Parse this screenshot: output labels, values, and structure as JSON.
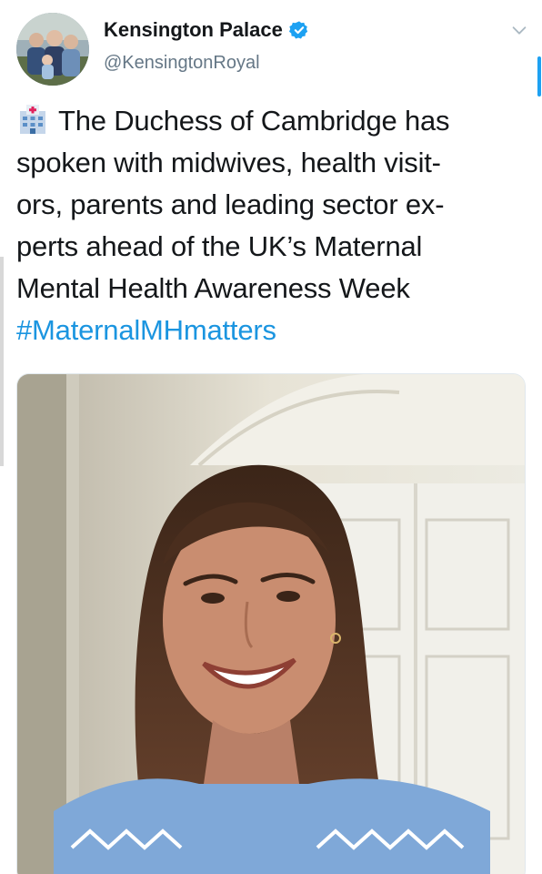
{
  "account": {
    "display_name": "Kensington Palace",
    "handle": "@KensingtonRoyal",
    "verified_icon": "verified-badge-icon",
    "menu_icon": "chevron-down-icon"
  },
  "tweet": {
    "lead_icon": "hospital-icon",
    "lines": [
      "The Duchess of Cambridge has",
      "spoken with midwives, health visit-",
      "ors, parents and leading sector ex-",
      "perts ahead of the UK’s Maternal",
      "Mental Health Awareness Week"
    ],
    "hashtag": "#MaternalMHmatters"
  },
  "media": {
    "type": "photo"
  },
  "colors": {
    "link": "#1b95e0",
    "verified": "#1da1f2",
    "secondary_text": "#657786"
  }
}
